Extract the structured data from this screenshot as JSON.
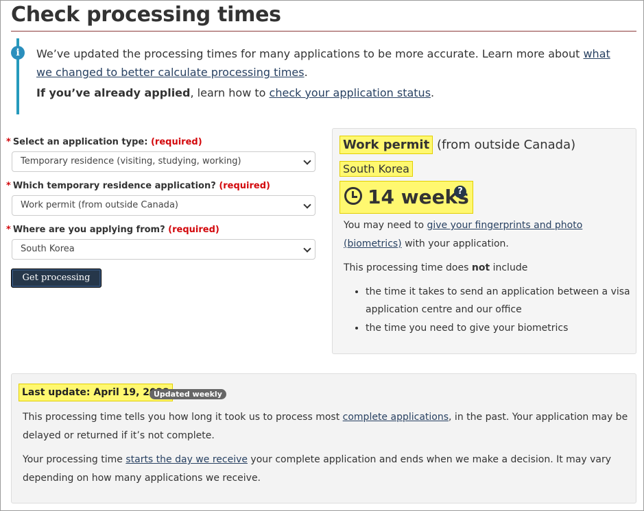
{
  "page": {
    "title": "Check processing times"
  },
  "notice": {
    "line1_pre": "We’ve updated the processing times for many applications to be more accurate. Learn more about ",
    "line1_link": "what we changed to better calculate processing times",
    "line1_post": ".",
    "line2_bold": "If you’ve already applied",
    "line2_mid": ", learn how to ",
    "line2_link": "check your application status",
    "line2_post": "."
  },
  "form": {
    "required_text": "(required)",
    "fields": [
      {
        "label": "Select an application type:",
        "value": "Temporary residence (visiting, studying, working)"
      },
      {
        "label": "Which temporary residence application?",
        "value": "Work permit (from outside Canada)"
      },
      {
        "label": "Where are you applying from?",
        "value": "South Korea"
      }
    ],
    "submit_label": "Get processing time"
  },
  "result": {
    "app_type": "Work permit",
    "app_qualifier": "(from outside Canada)",
    "country": "South Korea",
    "time": "14 weeks",
    "bio_pre": "You may need to ",
    "bio_link": "give your fingerprints and photo (biometrics)",
    "bio_post": " with your application.",
    "not_pre": "This processing time does ",
    "not_bold": "not",
    "not_post": " include",
    "exclusions": [
      "the time it takes to send an application between a visa application centre and our office",
      "the time you need to give your biometrics"
    ]
  },
  "update": {
    "label": "Last update: April 19, 2022",
    "badge": "Updated weekly",
    "p1_pre": "This processing time tells you how long it took us to process most ",
    "p1_link": "complete applications",
    "p1_post": ", in the past. Your application may be delayed or returned if it’s not complete.",
    "p2_pre": "Your processing time ",
    "p2_link": "starts the day we receive",
    "p2_post": " your complete application and ends when we make a decision. It may vary depending on how many applications we receive."
  },
  "colors": {
    "accent": "#269abc",
    "button": "#26374a",
    "required": "#d3080c",
    "highlight": "#fff870",
    "title_rule": "#8b3a3a"
  },
  "icons": {
    "info": "info-icon",
    "clock": "clock-icon",
    "help": "help-icon",
    "chevron": "chevron-down-icon"
  }
}
